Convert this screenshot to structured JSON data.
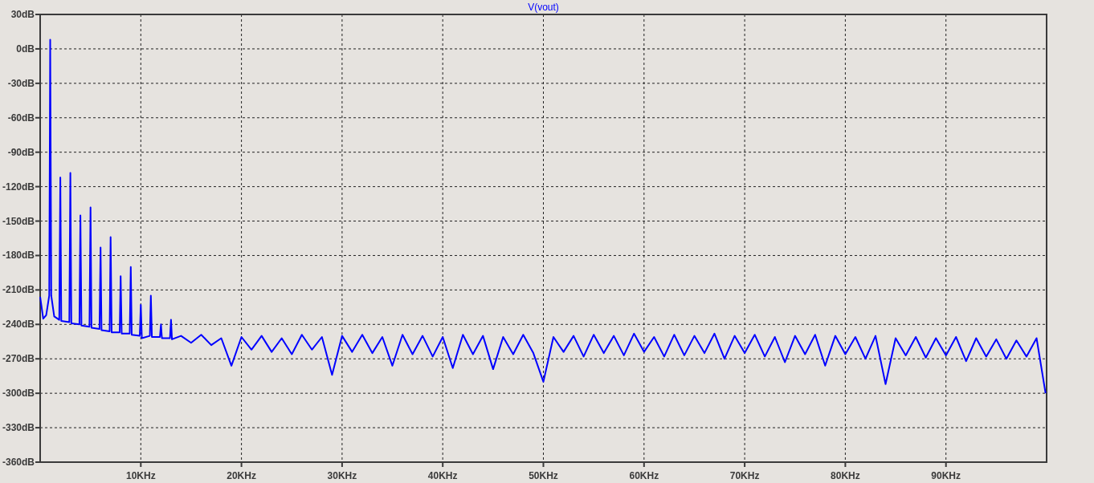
{
  "chart_data": {
    "type": "line",
    "grid": true,
    "xlim": [
      0,
      100
    ],
    "ylim": [
      -360,
      30
    ],
    "xticks": [
      {
        "value": 10,
        "label": "10KHz"
      },
      {
        "value": 20,
        "label": "20KHz"
      },
      {
        "value": 30,
        "label": "30KHz"
      },
      {
        "value": 40,
        "label": "40KHz"
      },
      {
        "value": 50,
        "label": "50KHz"
      },
      {
        "value": 60,
        "label": "60KHz"
      },
      {
        "value": 70,
        "label": "70KHz"
      },
      {
        "value": 80,
        "label": "80KHz"
      },
      {
        "value": 90,
        "label": "90KHz"
      }
    ],
    "yticks": [
      {
        "value": 30,
        "label": "30dB"
      },
      {
        "value": 0,
        "label": "0dB"
      },
      {
        "value": -30,
        "label": "-30dB"
      },
      {
        "value": -60,
        "label": "-60dB"
      },
      {
        "value": -90,
        "label": "-90dB"
      },
      {
        "value": -120,
        "label": "-120dB"
      },
      {
        "value": -150,
        "label": "-150dB"
      },
      {
        "value": -180,
        "label": "-180dB"
      },
      {
        "value": -210,
        "label": "-210dB"
      },
      {
        "value": -240,
        "label": "-240dB"
      },
      {
        "value": -270,
        "label": "-270dB"
      },
      {
        "value": -300,
        "label": "-300dB"
      },
      {
        "value": -330,
        "label": "-330dB"
      },
      {
        "value": -360,
        "label": "-360dB"
      }
    ],
    "x": [
      0,
      0.3,
      0.6,
      0.9,
      1,
      1.1,
      1.4,
      1.9,
      2,
      2.1,
      2.9,
      3,
      3.1,
      3.9,
      4,
      4.1,
      4.9,
      5,
      5.1,
      5.9,
      6,
      6.1,
      6.9,
      7,
      7.1,
      7.9,
      8,
      8.1,
      8.9,
      9,
      9.1,
      9.9,
      10,
      10.1,
      10.9,
      11,
      11.1,
      11.9,
      12,
      12.1,
      12.9,
      13,
      13.1,
      14,
      15,
      16,
      17,
      18,
      19,
      20,
      21,
      22,
      23,
      24,
      25,
      26,
      27,
      28,
      29,
      30,
      31,
      32,
      33,
      34,
      35,
      36,
      37,
      38,
      39,
      40,
      41,
      42,
      43,
      44,
      45,
      46,
      47,
      48,
      49,
      50,
      51,
      52,
      53,
      54,
      55,
      56,
      57,
      58,
      59,
      60,
      61,
      62,
      63,
      64,
      65,
      66,
      67,
      68,
      69,
      70,
      71,
      72,
      73,
      74,
      75,
      76,
      77,
      78,
      79,
      80,
      81,
      82,
      83,
      84,
      85,
      86,
      87,
      88,
      89,
      90,
      91,
      92,
      93,
      94,
      95,
      96,
      97,
      98,
      99,
      99.9
    ],
    "series": [
      {
        "name": "V(vout)",
        "color": "#0000ff",
        "values": [
          -216,
          -235,
          -232,
          -215,
          8,
          -215,
          -233,
          -236,
          -112,
          -237,
          -238,
          -108,
          -239,
          -240,
          -145,
          -241,
          -242,
          -138,
          -243,
          -244,
          -173,
          -245,
          -246,
          -164,
          -247,
          -247,
          -198,
          -248,
          -248,
          -190,
          -249,
          -250,
          -223,
          -252,
          -250,
          -215,
          -251,
          -251,
          -240,
          -252,
          -252,
          -236,
          -253,
          -250,
          -256,
          -249,
          -258,
          -252,
          -276,
          -251,
          -262,
          -250,
          -264,
          -252,
          -266,
          -249,
          -262,
          -251,
          -284,
          -250,
          -264,
          -249,
          -265,
          -251,
          -276,
          -249,
          -266,
          -250,
          -268,
          -251,
          -278,
          -249,
          -266,
          -250,
          -279,
          -251,
          -266,
          -249,
          -265,
          -290,
          -251,
          -264,
          -250,
          -268,
          -249,
          -265,
          -250,
          -267,
          -248,
          -264,
          -251,
          -268,
          -249,
          -267,
          -250,
          -265,
          -248,
          -270,
          -250,
          -265,
          -249,
          -268,
          -251,
          -273,
          -250,
          -266,
          -249,
          -276,
          -250,
          -266,
          -251,
          -270,
          -250,
          -292,
          -252,
          -267,
          -251,
          -269,
          -252,
          -267,
          -251,
          -272,
          -252,
          -268,
          -253,
          -270,
          -254,
          -268,
          -252,
          -300
        ]
      }
    ]
  }
}
